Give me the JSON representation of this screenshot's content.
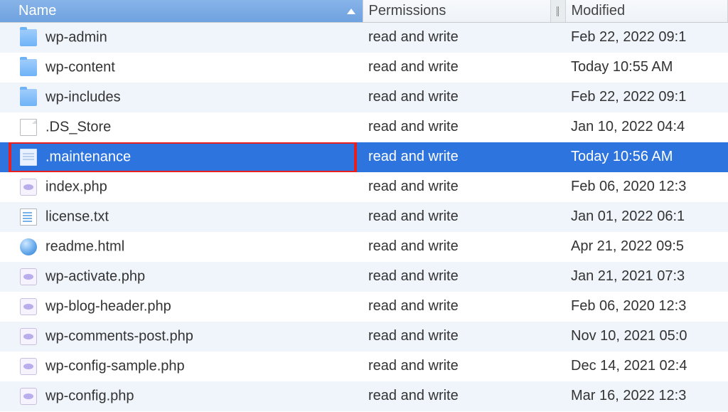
{
  "columns": {
    "name": "Name",
    "permissions": "Permissions",
    "modified": "Modified"
  },
  "rows": [
    {
      "icon": "folder",
      "name": "wp-admin",
      "permissions": "read and write",
      "modified": "Feb 22, 2022 09:1",
      "selected": false,
      "highlighted": false
    },
    {
      "icon": "folder",
      "name": "wp-content",
      "permissions": "read and write",
      "modified": "Today 10:55 AM",
      "selected": false,
      "highlighted": false
    },
    {
      "icon": "folder",
      "name": "wp-includes",
      "permissions": "read and write",
      "modified": "Feb 22, 2022 09:1",
      "selected": false,
      "highlighted": false
    },
    {
      "icon": "file-blank",
      "name": ".DS_Store",
      "permissions": "read and write",
      "modified": "Jan 10, 2022 04:4",
      "selected": false,
      "highlighted": false
    },
    {
      "icon": "doc",
      "name": ".maintenance",
      "permissions": "read and write",
      "modified": "Today 10:56 AM",
      "selected": true,
      "highlighted": true
    },
    {
      "icon": "php",
      "name": "index.php",
      "permissions": "read and write",
      "modified": "Feb 06, 2020 12:3",
      "selected": false,
      "highlighted": false
    },
    {
      "icon": "txt",
      "name": "license.txt",
      "permissions": "read and write",
      "modified": "Jan 01, 2022 06:1",
      "selected": false,
      "highlighted": false
    },
    {
      "icon": "html",
      "name": "readme.html",
      "permissions": "read and write",
      "modified": "Apr 21, 2022 09:5",
      "selected": false,
      "highlighted": false
    },
    {
      "icon": "php",
      "name": "wp-activate.php",
      "permissions": "read and write",
      "modified": "Jan 21, 2021 07:3",
      "selected": false,
      "highlighted": false
    },
    {
      "icon": "php",
      "name": "wp-blog-header.php",
      "permissions": "read and write",
      "modified": "Feb 06, 2020 12:3",
      "selected": false,
      "highlighted": false
    },
    {
      "icon": "php",
      "name": "wp-comments-post.php",
      "permissions": "read and write",
      "modified": "Nov 10, 2021 05:0",
      "selected": false,
      "highlighted": false
    },
    {
      "icon": "php",
      "name": "wp-config-sample.php",
      "permissions": "read and write",
      "modified": "Dec 14, 2021 02:4",
      "selected": false,
      "highlighted": false
    },
    {
      "icon": "php",
      "name": "wp-config.php",
      "permissions": "read and write",
      "modified": "Mar 16, 2022 12:3",
      "selected": false,
      "highlighted": false
    }
  ]
}
